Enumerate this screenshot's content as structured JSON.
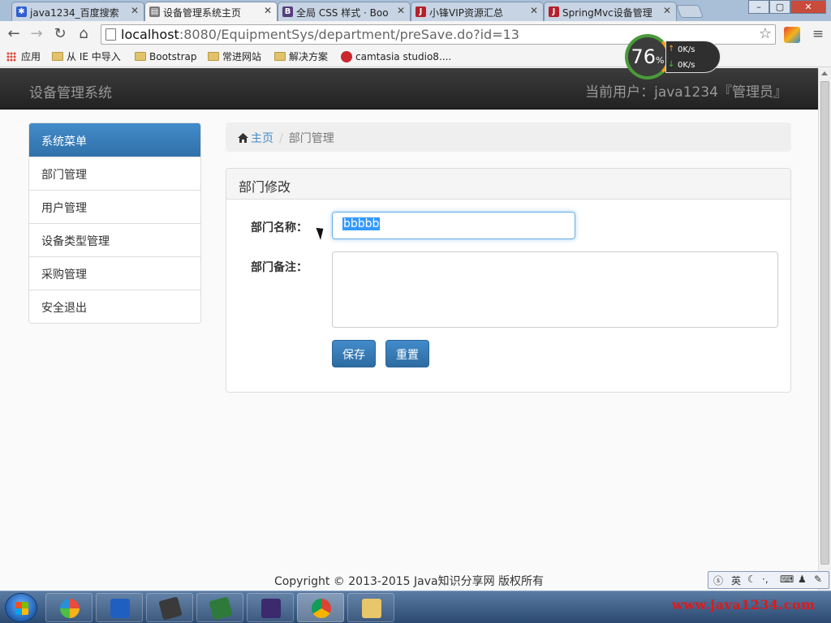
{
  "browser": {
    "tabs": [
      {
        "title": "java1234_百度搜索",
        "favicon": "baidu-icon",
        "color": "#2f5fd0"
      },
      {
        "title": "设备管理系统主页",
        "favicon": "page-favicon-icon",
        "color": "#7a7a7a"
      },
      {
        "title": "全局 CSS 样式 · Boo",
        "favicon": "bootstrap-icon",
        "color": "#563d7c"
      },
      {
        "title": "小锋VIP资源汇总",
        "favicon": "java1234-icon",
        "color": "#b5202a"
      },
      {
        "title": "SpringMvc设备管理",
        "favicon": "java1234-icon",
        "color": "#b5202a"
      }
    ],
    "active_tab": 1,
    "url_host": "localhost",
    "url_path": ":8080/EquipmentSys/department/preSave.do?id=13",
    "bookmarks": [
      "应用",
      "从 IE 中导入",
      "Bootstrap",
      "常进网站",
      "解决方案",
      "camtasia studio8...."
    ]
  },
  "speed_widget": {
    "percent": "76",
    "percent_sign": "%",
    "up": "0",
    "down": "0",
    "unit": "K/s"
  },
  "app": {
    "brand": "设备管理系统",
    "current_user": "当前用户：java1234『管理员』"
  },
  "sidebar": {
    "title": "系统菜单",
    "items": [
      "部门管理",
      "用户管理",
      "设备类型管理",
      "采购管理",
      "安全退出"
    ]
  },
  "breadcrumb": {
    "home": "主页",
    "separator": "/",
    "current": "部门管理"
  },
  "form": {
    "heading": "部门修改",
    "name_label": "部门名称：",
    "name_value": "bbbbb",
    "remark_label": "部门备注：",
    "remark_value": "",
    "save_label": "保存",
    "reset_label": "重置"
  },
  "footer": "Copyright © 2013-2015 Java知识分享网 版权所有",
  "ime": {
    "lang": "英"
  },
  "watermark": "www.java1234.com",
  "colors": {
    "primary": "#428bca",
    "navbar": "#222222",
    "watermark": "#e01818"
  }
}
